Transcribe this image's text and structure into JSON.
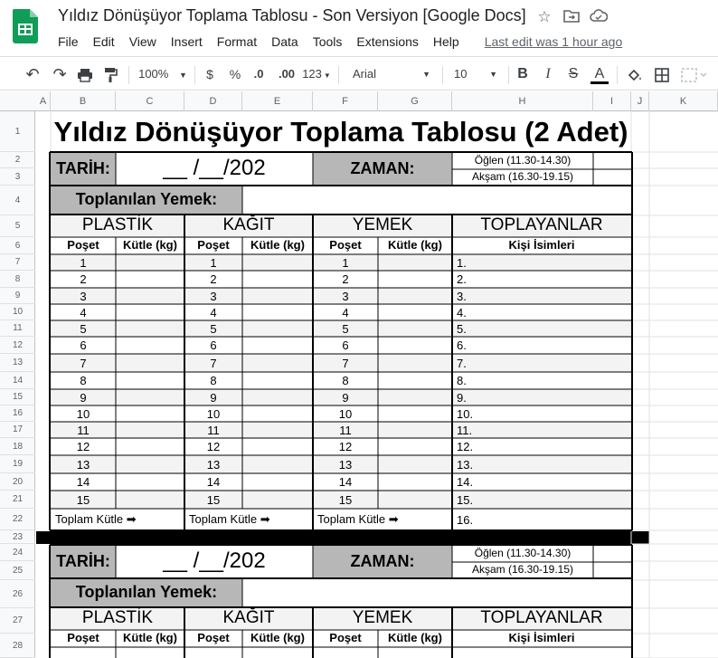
{
  "app": {
    "doc_title": "Yıldız Dönüşüyor Toplama Tablosu - Son Versiyon [Google Docs]",
    "menu": [
      "File",
      "Edit",
      "View",
      "Insert",
      "Format",
      "Data",
      "Tools",
      "Extensions",
      "Help"
    ],
    "last_edit": "Last edit was 1 hour ago",
    "icons": [
      "star-icon",
      "move-to-folder-icon",
      "cloud-status-icon"
    ]
  },
  "toolbar": {
    "zoom": "100%",
    "currency": "$",
    "percent": "%",
    "decrease_decimal": ".0",
    "increase_decimal": ".00",
    "more_formats": "123",
    "font": "Arial",
    "font_size": "10",
    "bold": "B",
    "italic": "I",
    "strike": "S",
    "text_color": "A"
  },
  "columns": [
    "A",
    "B",
    "C",
    "D",
    "E",
    "F",
    "G",
    "H",
    "I",
    "J",
    "K"
  ],
  "rows": [
    "1",
    "2",
    "3",
    "4",
    "5",
    "6",
    "7",
    "8",
    "9",
    "10",
    "11",
    "12",
    "13",
    "14",
    "15",
    "16",
    "17",
    "18",
    "19",
    "20",
    "21",
    "22",
    "23",
    "24",
    "25",
    "26",
    "27",
    "28"
  ],
  "sheet": {
    "title": "Yıldız Dönüşüyor Toplama Tablosu (2 Adet)",
    "tarih_label": "TARİH:",
    "date_placeholder": "__ /__/202",
    "zaman_label": "ZAMAN:",
    "oglen": "Öğlen  (11.30-14.30)",
    "aksam": "Akşam (16.30-19.15)",
    "toplanilan": "Toplanılan Yemek:",
    "sections": [
      "PLASTİK",
      "KAĞIT",
      "YEMEK",
      "TOPLAYANLAR"
    ],
    "poset": "Poşet",
    "kutle": "Kütle (kg)",
    "kisi": "Kişi İsimleri",
    "numbers": [
      "1",
      "2",
      "3",
      "4",
      "5",
      "6",
      "7",
      "8",
      "9",
      "10",
      "11",
      "12",
      "13",
      "14",
      "15"
    ],
    "names": [
      "1.",
      "2.",
      "3.",
      "4.",
      "5.",
      "6.",
      "7.",
      "8.",
      "9.",
      "10.",
      "11.",
      "12.",
      "13.",
      "14.",
      "15.",
      "16."
    ],
    "toplam": "Toplam Kütle ➡"
  }
}
